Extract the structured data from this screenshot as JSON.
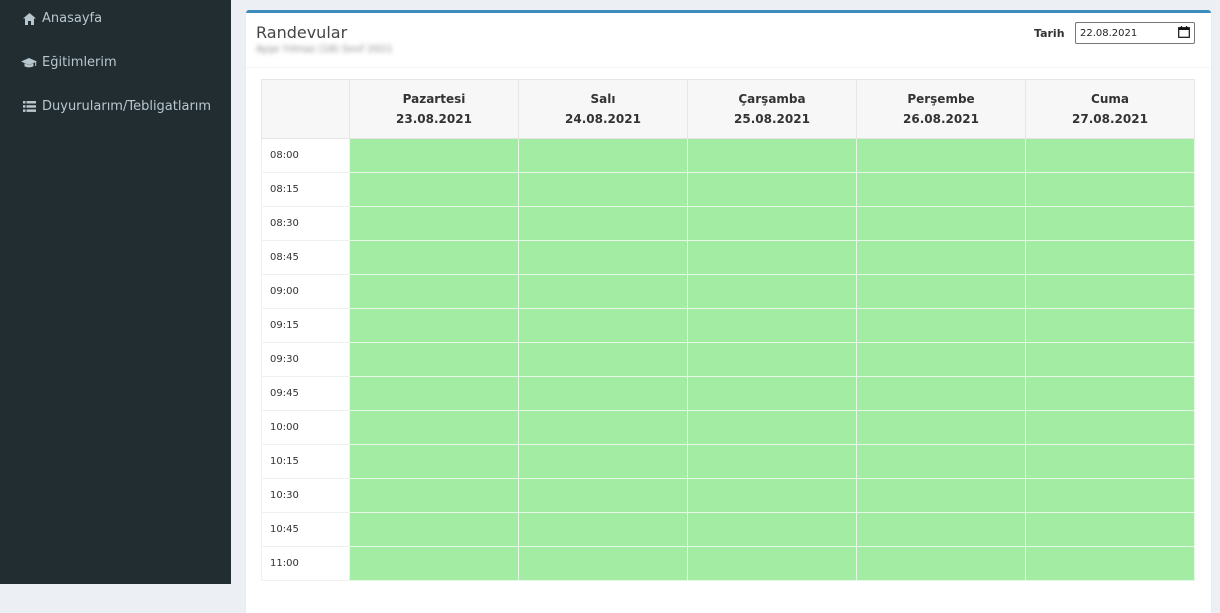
{
  "sidebar": {
    "items": [
      {
        "label": "Anasayfa",
        "icon": "home-icon"
      },
      {
        "label": "Eğitimlerim",
        "icon": "graduation-cap-icon"
      },
      {
        "label": "Duyurularım/Tebligatlarım",
        "icon": "list-icon"
      }
    ]
  },
  "box": {
    "title": "Randevular",
    "subtitle": "Ayşe Yılmaz (18) Sınıf 2021",
    "date_label": "Tarih",
    "date_value": "22.08.2021"
  },
  "schedule": {
    "days": [
      {
        "name": "Pazartesi",
        "date": "23.08.2021"
      },
      {
        "name": "Salı",
        "date": "24.08.2021"
      },
      {
        "name": "Çarşamba",
        "date": "25.08.2021"
      },
      {
        "name": "Perşembe",
        "date": "26.08.2021"
      },
      {
        "name": "Cuma",
        "date": "27.08.2021"
      }
    ],
    "times": [
      "08:00",
      "08:15",
      "08:30",
      "08:45",
      "09:00",
      "09:15",
      "09:30",
      "09:45",
      "10:00",
      "10:15",
      "10:30",
      "10:45",
      "11:00"
    ],
    "slot_color": "#a3eca3"
  },
  "colors": {
    "sidebar_bg": "#222d32",
    "accent": "#3c8dbc"
  }
}
